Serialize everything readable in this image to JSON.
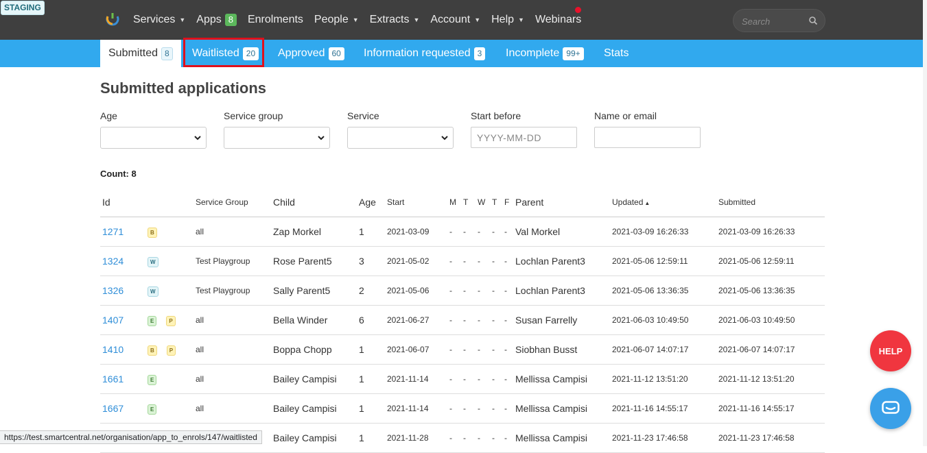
{
  "env_badge": "STAGING",
  "nav": {
    "items": [
      {
        "label": "Services",
        "caret": true
      },
      {
        "label": "Apps",
        "badge": "8"
      },
      {
        "label": "Enrolments"
      },
      {
        "label": "People",
        "caret": true
      },
      {
        "label": "Extracts",
        "caret": true
      },
      {
        "label": "Account",
        "caret": true
      },
      {
        "label": "Help",
        "caret": true
      },
      {
        "label": "Webinars"
      }
    ],
    "search_placeholder": "Search"
  },
  "tabs": [
    {
      "label": "Submitted",
      "count": "8"
    },
    {
      "label": "Waitlisted",
      "count": "20"
    },
    {
      "label": "Approved",
      "count": "60"
    },
    {
      "label": "Information requested",
      "count": "3"
    },
    {
      "label": "Incomplete",
      "count": "99+"
    },
    {
      "label": "Stats"
    }
  ],
  "page_title": "Submitted applications",
  "filters": {
    "age_label": "Age",
    "service_group_label": "Service group",
    "service_label": "Service",
    "start_before_label": "Start before",
    "start_before_placeholder": "YYYY-MM-DD",
    "name_email_label": "Name or email"
  },
  "count_text": "Count: 8",
  "table": {
    "headers": {
      "id": "Id",
      "service_group": "Service Group",
      "child": "Child",
      "age": "Age",
      "start": "Start",
      "m": "M",
      "t": "T",
      "w": "W",
      "th": "T",
      "f": "F",
      "parent": "Parent",
      "updated": "Updated",
      "updated_sort": "▲",
      "submitted": "Submitted"
    },
    "rows": [
      {
        "id": "1271",
        "badges": [
          "B"
        ],
        "group": "all",
        "child": "Zap Morkel",
        "age": "1",
        "start": "2021-03-09",
        "parent": "Val Morkel",
        "updated": "2021-03-09 16:26:33",
        "submitted": "2021-03-09 16:26:33"
      },
      {
        "id": "1324",
        "badges": [
          "W"
        ],
        "group": "Test Playgroup",
        "child": "Rose Parent5",
        "age": "3",
        "start": "2021-05-02",
        "parent": "Lochlan Parent3",
        "updated": "2021-05-06 12:59:11",
        "submitted": "2021-05-06 12:59:11"
      },
      {
        "id": "1326",
        "badges": [
          "W"
        ],
        "group": "Test Playgroup",
        "child": "Sally Parent5",
        "age": "2",
        "start": "2021-05-06",
        "parent": "Lochlan Parent3",
        "updated": "2021-05-06 13:36:35",
        "submitted": "2021-05-06 13:36:35"
      },
      {
        "id": "1407",
        "badges": [
          "E",
          "P"
        ],
        "group": "all",
        "child": "Bella Winder",
        "age": "6",
        "start": "2021-06-27",
        "parent": "Susan Farrelly",
        "updated": "2021-06-03 10:49:50",
        "submitted": "2021-06-03 10:49:50"
      },
      {
        "id": "1410",
        "badges": [
          "B",
          "P"
        ],
        "group": "all",
        "child": "Boppa Chopp",
        "age": "1",
        "start": "2021-06-07",
        "parent": "Siobhan Busst",
        "updated": "2021-06-07 14:07:17",
        "submitted": "2021-06-07 14:07:17"
      },
      {
        "id": "1661",
        "badges": [
          "E"
        ],
        "group": "all",
        "child": "Bailey Campisi",
        "age": "1",
        "start": "2021-11-14",
        "parent": "Mellissa Campisi",
        "updated": "2021-11-12 13:51:20",
        "submitted": "2021-11-12 13:51:20"
      },
      {
        "id": "1667",
        "badges": [
          "E"
        ],
        "group": "all",
        "child": "Bailey Campisi",
        "age": "1",
        "start": "2021-11-14",
        "parent": "Mellissa Campisi",
        "updated": "2021-11-16 14:55:17",
        "submitted": "2021-11-16 14:55:17"
      },
      {
        "id": "",
        "badges": [],
        "group": "",
        "child": "Bailey Campisi",
        "age": "1",
        "start": "2021-11-28",
        "parent": "Mellissa Campisi",
        "updated": "2021-11-23 17:46:58",
        "submitted": "2021-11-23 17:46:58"
      }
    ],
    "day_placeholder": "-"
  },
  "help_button_label": "HELP",
  "status_url": "https://test.smartcentral.net/organisation/app_to_enrols/147/waitlisted",
  "colors": {
    "topbar": "#3f3f3f",
    "tabbar": "#31a9ee",
    "link": "#2f8ed8",
    "help": "#f0363f",
    "chat": "#3aa0e8",
    "highlight": "#e0101c"
  }
}
